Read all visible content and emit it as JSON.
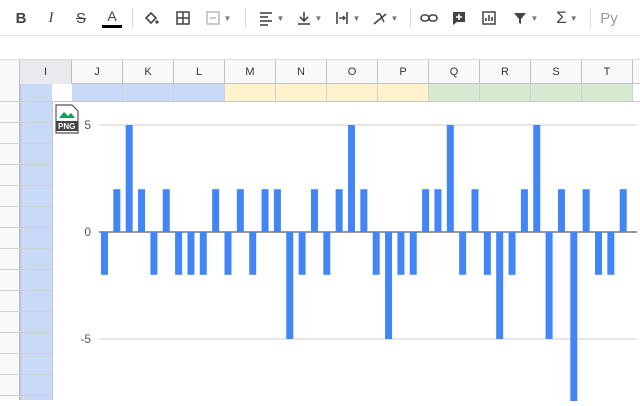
{
  "toolbar": {
    "buttons": [
      {
        "name": "bold-button",
        "glyph": "B"
      },
      {
        "name": "italic-button",
        "glyph": "I"
      },
      {
        "name": "strikethrough-button",
        "glyph": "S"
      },
      {
        "name": "text-color-button",
        "glyph": "A"
      },
      {
        "name": "fill-color-button",
        "icon": "paint-bucket-icon"
      },
      {
        "name": "borders-button",
        "icon": "borders-icon"
      },
      {
        "name": "merge-cells-button",
        "icon": "merge-icon"
      },
      {
        "name": "horizontal-align-button",
        "icon": "align-left-icon"
      },
      {
        "name": "vertical-align-button",
        "icon": "align-bottom-icon"
      },
      {
        "name": "text-wrapping-button",
        "icon": "wrap-icon"
      },
      {
        "name": "text-rotation-button",
        "icon": "rotate-icon"
      },
      {
        "name": "insert-link-button",
        "icon": "link-icon"
      },
      {
        "name": "insert-comment-button",
        "icon": "comment-plus-icon"
      },
      {
        "name": "insert-chart-button",
        "icon": "chart-icon"
      },
      {
        "name": "filter-button",
        "icon": "filter-icon"
      },
      {
        "name": "functions-button",
        "glyph": "Σ"
      },
      {
        "name": "input-tools-button",
        "glyph": "Ру"
      }
    ]
  },
  "columns": [
    "I",
    "J",
    "K",
    "L",
    "M",
    "N",
    "O",
    "P",
    "Q",
    "R",
    "S",
    "T"
  ],
  "colors": {
    "blue_band": "#c9daf8",
    "yellow_band": "#fff2cc",
    "green_band": "#d9ead3",
    "bar": "#4285f4"
  },
  "chart_data": {
    "type": "bar",
    "title": "",
    "xlabel": "",
    "ylabel": "",
    "ylim": [
      -7.5,
      5
    ],
    "yticks": [
      5,
      0,
      -5
    ],
    "ytick_labels": [
      "5",
      "0",
      "-5"
    ],
    "gridlines": true,
    "values": [
      -2,
      2,
      5,
      2,
      -2,
      2,
      -2,
      -2,
      -2,
      2,
      -2,
      2,
      -2,
      2,
      2,
      -5,
      -2,
      2,
      -2,
      2,
      5,
      2,
      -2,
      -5,
      -2,
      -2,
      2,
      2,
      5,
      -2,
      2,
      -2,
      -5,
      -2,
      2,
      5,
      -5,
      2,
      -8,
      2,
      -2,
      -2,
      2
    ]
  },
  "badge": {
    "label": "PNG"
  }
}
